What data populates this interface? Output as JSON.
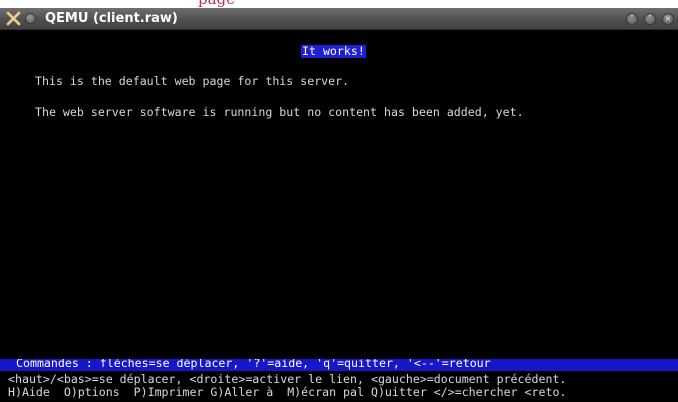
{
  "page_top": {
    "partial_text": "page"
  },
  "window": {
    "title": "QEMU (client.raw)",
    "icons": {
      "app": "x-window-icon",
      "menu": "window-menu-icon",
      "minimize": "minimize-icon",
      "maximize": "maximize-icon",
      "close": "close-icon"
    },
    "buttons": {
      "minimize_glyph": "˅",
      "maximize_glyph": "˄",
      "close_glyph": "×"
    }
  },
  "terminal": {
    "heading": "It works!",
    "paragraphs": [
      "This is the default web page for this server.",
      "The web server software is running but no content has been added, yet."
    ],
    "status_line": "Commandes : flèches=se déplacer, '?'=aide, 'q'=quitter, '<--'=retour",
    "help_lines": [
      "<haut>/<bas>=se déplacer, <droite>=activer le lien, <gauche>=document précédent.",
      "H)Aide  O)ptions  P)Imprimer G)Aller à  M)écran pal Q)uitter </>=chercher <reto."
    ]
  },
  "colors": {
    "terminal_bg": "#000000",
    "terminal_text": "#d8d8d8",
    "highlight_bg": "#1f1fd6",
    "status_bg": "#1717c9",
    "titlebar": "#4f4f4f"
  }
}
